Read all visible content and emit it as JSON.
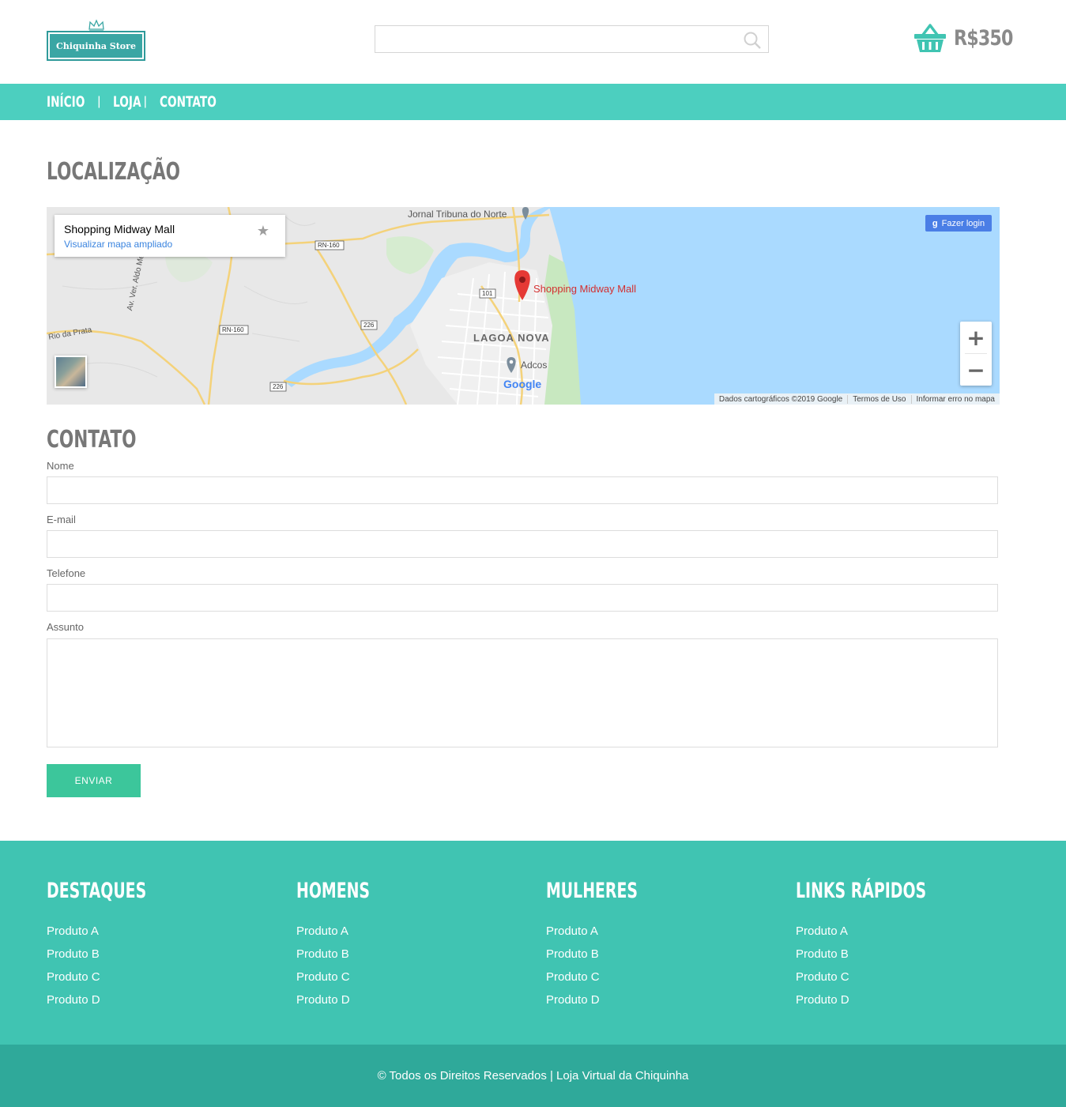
{
  "header": {
    "logo_text": "Chiquinha Store",
    "search": {
      "value": "",
      "placeholder": ""
    },
    "cart_total": "R$350"
  },
  "nav": {
    "items": [
      {
        "label": "INÍCIO"
      },
      {
        "label": "LOJA"
      },
      {
        "label": "CONTATO"
      }
    ],
    "separator": "|"
  },
  "location": {
    "title": "LOCALIZAÇÃO",
    "map": {
      "place_name": "Shopping Midway Mall",
      "place_link": "Visualizar mapa ampliado",
      "login_label": "Fazer login",
      "zoom_in": "+",
      "zoom_out": "−",
      "labels": {
        "newspaper": "Jornal Tribuna do Norte",
        "marker": "Shopping Midway Mall",
        "district": "LAGOA NOVA",
        "adcos": "Adcos",
        "road_rn160_a": "RN-160",
        "road_rn160_b": "RN-160",
        "road_101": "101",
        "road_226_a": "226",
        "road_226_b": "226",
        "street_aldo": "Av. Ver. Aldo Mendes de",
        "rio_prata": "Rio da Prata",
        "google": "Google"
      },
      "footer": {
        "data": "Dados cartográficos ©2019 Google",
        "terms": "Termos de Uso",
        "report": "Informar erro no mapa"
      },
      "colors": {
        "water": "#aadaff",
        "park": "#c8e8c0",
        "land": "#e8e8e8",
        "road": "#f4d27a",
        "marker": "#e53935"
      }
    }
  },
  "contact": {
    "title": "CONTATO",
    "fields": {
      "name_label": "Nome",
      "name_value": "",
      "email_label": "E-mail",
      "email_value": "",
      "phone_label": "Telefone",
      "phone_value": "",
      "subject_label": "Assunto",
      "subject_value": ""
    },
    "submit_label": "ENVIAR"
  },
  "footer": {
    "columns": [
      {
        "title": "DESTAQUES",
        "links": [
          "Produto A",
          "Produto B",
          "Produto C",
          "Produto D"
        ]
      },
      {
        "title": "HOMENS",
        "links": [
          "Produto A",
          "Produto B",
          "Produto C",
          "Produto D"
        ]
      },
      {
        "title": "MULHERES",
        "links": [
          "Produto A",
          "Produto B",
          "Produto C",
          "Produto D"
        ]
      },
      {
        "title": "LINKS RÁPIDOS",
        "links": [
          "Produto A",
          "Produto B",
          "Produto C",
          "Produto D"
        ]
      }
    ],
    "copyright": "© Todos os Direitos Reservados | Loja Virtual da Chiquinha"
  },
  "colors": {
    "accent_nav": "#4ccfbf",
    "footer_bg": "#40c4b2",
    "copyright_bg": "#2fa99a",
    "button": "#3cc69b",
    "logo": "#3aa6a4"
  },
  "icons": {
    "logo_crown": "crown-icon",
    "search": "search-icon",
    "cart": "basket-icon",
    "star": "star-icon",
    "marker": "map-pin-icon"
  }
}
